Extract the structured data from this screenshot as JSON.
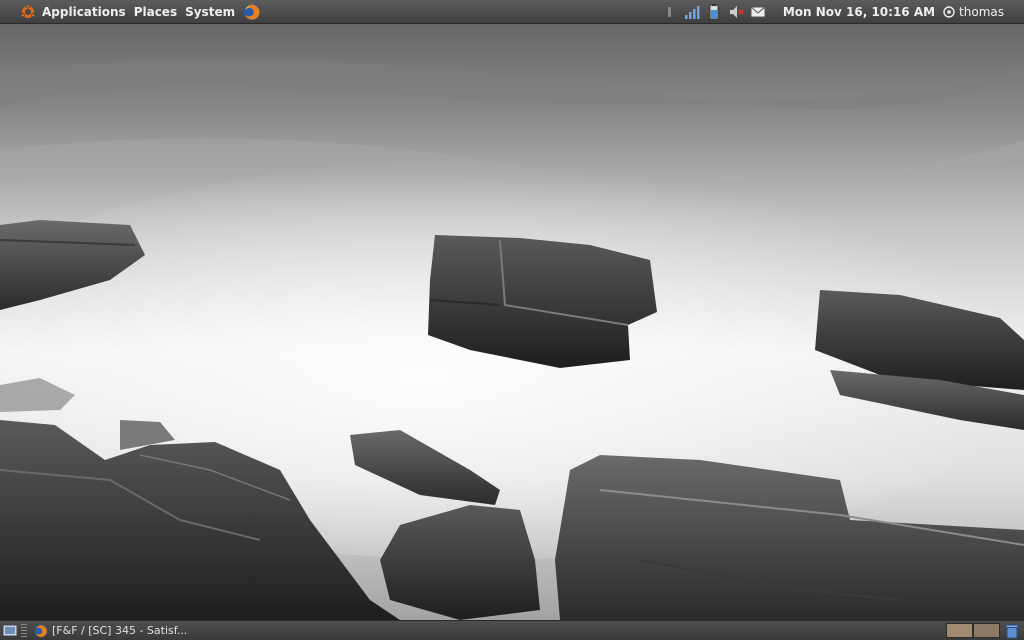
{
  "top_panel": {
    "menus": {
      "applications": "Applications",
      "places": "Places",
      "system": "System"
    },
    "clock": "Mon Nov 16, 10:16 AM",
    "user": "thomas",
    "icons": [
      "ubuntu-logo-icon",
      "firefox-icon",
      "keyboard-layout-icon",
      "network-signal-icon",
      "battery-icon",
      "volume-muted-icon",
      "mail-icon",
      "user-icon"
    ]
  },
  "bottom_panel": {
    "taskbar_item": "[F&F / [SC] 345 - Satisf...",
    "workspaces": [
      "workspace-1",
      "workspace-2"
    ],
    "icons": [
      "show-desktop-icon",
      "firefox-icon",
      "trash-icon"
    ]
  },
  "colors": {
    "panel_top": "#5c5c5c",
    "panel_bottom": "#3f3f3f",
    "panel_text": "#eeeeee",
    "workspace_active": "#a08a70"
  }
}
